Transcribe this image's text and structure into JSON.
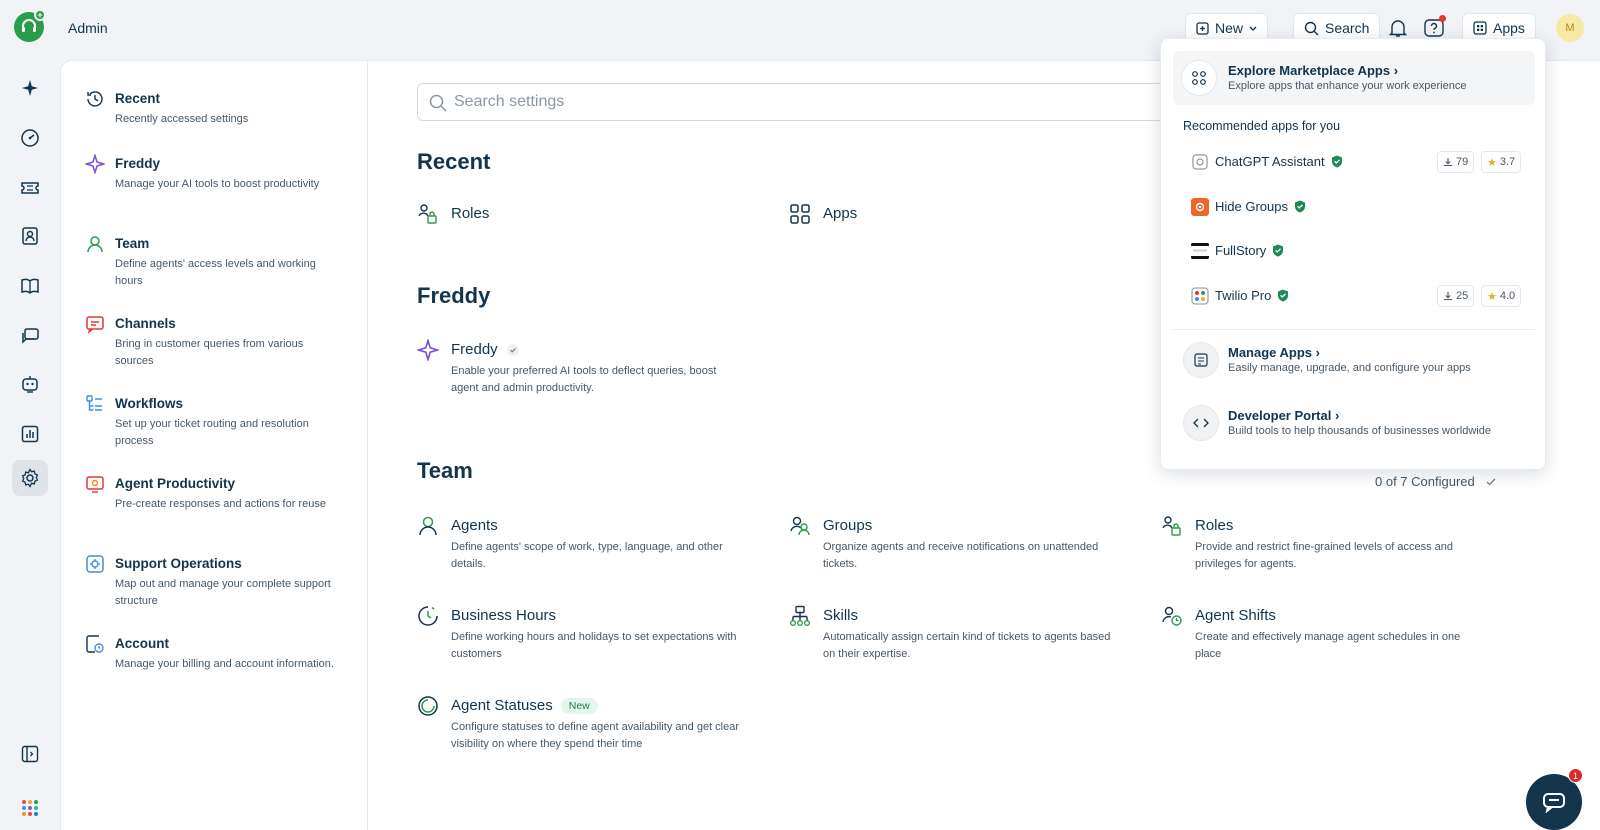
{
  "header": {
    "title": "Admin",
    "new_label": "New",
    "search_label": "Search",
    "apps_label": "Apps",
    "avatar_initial": "M"
  },
  "rail": {
    "icons": [
      "freddy-ai-icon",
      "dashboard-icon",
      "tickets-icon",
      "contacts-icon",
      "solutions-icon",
      "conversations-icon",
      "bot-icon",
      "reports-icon",
      "settings-icon"
    ],
    "active": "settings-icon"
  },
  "nav": {
    "items": [
      {
        "title": "Recent",
        "desc": "Recently accessed settings"
      },
      {
        "title": "Freddy",
        "desc": "Manage your AI tools to boost productivity"
      },
      {
        "title": "Team",
        "desc": "Define agents' access levels and working hours"
      },
      {
        "title": "Channels",
        "desc": "Bring in customer queries from various sources"
      },
      {
        "title": "Workflows",
        "desc": "Set up your ticket routing and resolution process"
      },
      {
        "title": "Agent Productivity",
        "desc": "Pre-create responses and actions for reuse"
      },
      {
        "title": "Support Operations",
        "desc": "Map out and manage your complete support structure"
      },
      {
        "title": "Account",
        "desc": "Manage your billing and account information."
      }
    ]
  },
  "search": {
    "placeholder": "Search settings"
  },
  "sections": {
    "recent": {
      "title": "Recent",
      "items": [
        "Roles",
        "Apps"
      ]
    },
    "freddy": {
      "title": "Freddy",
      "card_title": "Freddy",
      "card_desc": "Enable your preferred AI tools to deflect queries, boost agent and admin productivity."
    },
    "team": {
      "title": "Team",
      "configured": "0 of 7 Configured",
      "cards": [
        {
          "title": "Agents",
          "desc": "Define agents' scope of work, type, language, and other details."
        },
        {
          "title": "Groups",
          "desc": "Organize agents and receive notifications on unattended tickets."
        },
        {
          "title": "Roles",
          "desc": "Provide and restrict fine-grained levels of access and privileges for agents."
        },
        {
          "title": "Business Hours",
          "desc": "Define working hours and holidays to set expectations with customers"
        },
        {
          "title": "Skills",
          "desc": "Automatically assign certain kind of tickets to agents based on their expertise."
        },
        {
          "title": "Agent Shifts",
          "desc": "Create and effectively manage agent schedules in one place"
        },
        {
          "title": "Agent Statuses",
          "desc": "Configure statuses to define agent availability and get clear visibility on where they spend their time",
          "badge": "New"
        }
      ]
    }
  },
  "apps_popover": {
    "explore_title": "Explore Marketplace Apps",
    "explore_desc": "Explore apps that enhance your work experience",
    "recommended_label": "Recommended apps for you",
    "apps": [
      {
        "name": "ChatGPT Assistant",
        "downloads": "79",
        "rating": "3.7"
      },
      {
        "name": "Hide Groups"
      },
      {
        "name": "FullStory"
      },
      {
        "name": "Twilio Pro",
        "downloads": "25",
        "rating": "4.0"
      }
    ],
    "manage_title": "Manage Apps",
    "manage_desc": "Easily manage, upgrade, and configure your apps",
    "dev_title": "Developer Portal",
    "dev_desc": "Build tools to help thousands of businesses worldwide"
  },
  "chat": {
    "badge": "1"
  },
  "colors": {
    "accent_green": "#2a9d4a",
    "freddy_purple": "#7b4ddb",
    "navy": "#12344d",
    "verified_green": "#1f8a55"
  }
}
